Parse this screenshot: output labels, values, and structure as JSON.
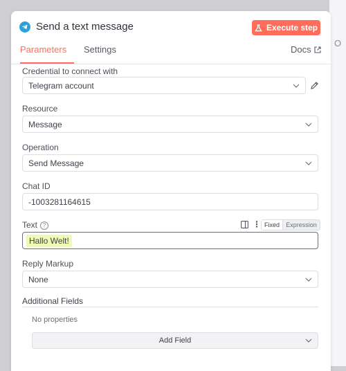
{
  "header": {
    "title": "Send a text message",
    "execute_label": "Execute step",
    "icon": "telegram-icon"
  },
  "tabs": [
    {
      "label": "Parameters",
      "active": true
    },
    {
      "label": "Settings",
      "active": false
    }
  ],
  "docs_label": "Docs",
  "side_letter": "O",
  "fields": {
    "credential": {
      "label": "Credential to connect with",
      "value": "Telegram account"
    },
    "resource": {
      "label": "Resource",
      "value": "Message"
    },
    "operation": {
      "label": "Operation",
      "value": "Send Message"
    },
    "chat_id": {
      "label": "Chat ID",
      "value": "-1003281164615"
    },
    "text": {
      "label": "Text",
      "value": "Hallo Welt!",
      "mode_fixed": "Fixed",
      "mode_expression": "Expression"
    },
    "reply_markup": {
      "label": "Reply Markup",
      "value": "None"
    }
  },
  "additional_fields": {
    "title": "Additional Fields",
    "empty_text": "No properties",
    "add_label": "Add Field"
  },
  "colors": {
    "accent": "#ff6d5a",
    "telegram": "#2aa1d9",
    "highlight": "#eefab3"
  }
}
